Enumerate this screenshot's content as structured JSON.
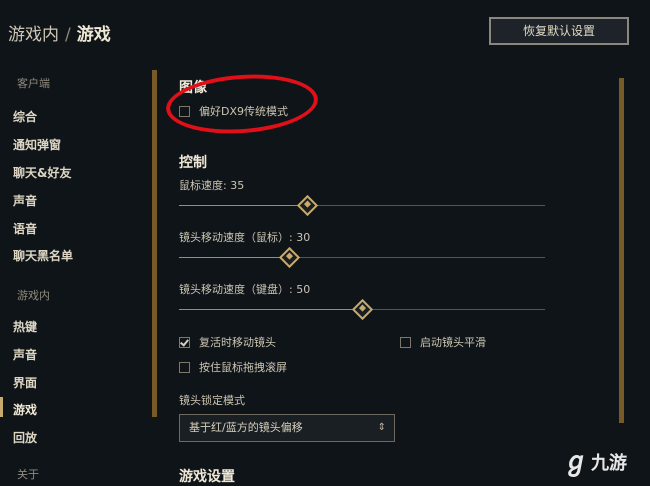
{
  "header": {
    "breadcrumb_parent": "游戏内",
    "breadcrumb_sep": "/",
    "breadcrumb_current": "游戏",
    "reset_button": "恢复默认设置"
  },
  "sidebar": {
    "client_heading": "客户端",
    "client_items": [
      "综合",
      "通知弹窗",
      "聊天&好友",
      "声音",
      "语音",
      "聊天黑名单"
    ],
    "ingame_heading": "游戏内",
    "ingame_items": [
      "热键",
      "声音",
      "界面",
      "游戏",
      "回放"
    ],
    "about_heading": "关于",
    "active_item": "游戏"
  },
  "graphics": {
    "title": "图像",
    "dx9_label": "偏好DX9传统模式",
    "dx9_checked": false
  },
  "control": {
    "title": "控制",
    "mouse_speed_label": "鼠标速度: 35",
    "mouse_speed_value": 35,
    "cam_speed_mouse_label": "镜头移动速度（鼠标）: 30",
    "cam_speed_mouse_value": 30,
    "cam_speed_keyboard_label": "镜头移动速度（键盘）: 50",
    "cam_speed_keyboard_value": 50,
    "move_cam_on_revive_label": "复活时移动镜头",
    "move_cam_on_revive_checked": true,
    "smooth_cam_label": "启动镜头平滑",
    "smooth_cam_checked": false,
    "drag_scroll_label": "按住鼠标拖拽滚屏",
    "drag_scroll_checked": false,
    "cam_lock_label": "镜头锁定模式",
    "cam_lock_value": "基于红/蓝方的镜头偏移"
  },
  "game_settings": {
    "title": "游戏设置"
  },
  "watermark": {
    "text": "九游"
  },
  "colors": {
    "accent_gold": "#c8aa6e",
    "annotation_red": "#e00f18",
    "background": "#0f1418"
  }
}
